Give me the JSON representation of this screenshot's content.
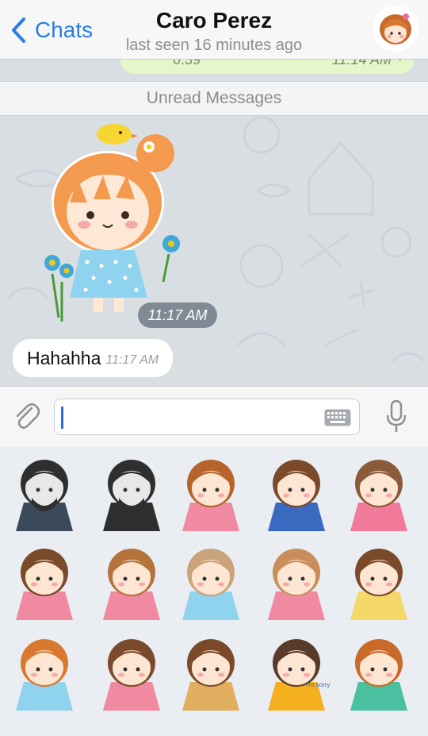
{
  "header": {
    "back_label": "Chats",
    "title": "Caro Perez",
    "subtitle": "last seen 16 minutes ago"
  },
  "chat": {
    "previous_bubble": {
      "text": "0:39",
      "time": "11:14 AM"
    },
    "unread_divider": "Unread Messages",
    "sticker_message": {
      "time": "11:17 AM"
    },
    "text_message": {
      "text": "Hahahha",
      "time": "11:17 AM"
    }
  },
  "input": {
    "placeholder": "",
    "value": ""
  },
  "sticker_panel": {
    "stickers": [
      {
        "name": "bearded-man-sticker"
      },
      {
        "name": "man-portrait-sticker"
      },
      {
        "name": "girl-sunglasses-sticker"
      },
      {
        "name": "girl-eating-sticker"
      },
      {
        "name": "girl-heart-sticker"
      },
      {
        "name": "girl-music-sticker"
      },
      {
        "name": "girl-smile-sticker"
      },
      {
        "name": "paper-bag-girl-sticker"
      },
      {
        "name": "chef-girl-sticker"
      },
      {
        "name": "girl-dancing-sticker"
      },
      {
        "name": "girl-bird-sticker"
      },
      {
        "name": "girl-hearts-sticker"
      },
      {
        "name": "girl-cookie-sticker"
      },
      {
        "name": "im-sorry-girl-sticker",
        "text": "I'm sorry"
      },
      {
        "name": "girl-blanket-sticker"
      }
    ]
  },
  "colors": {
    "accent": "#2a7ee0",
    "outgoing_bubble": "#e3f7c9",
    "time_pill": "#7f8a94"
  }
}
